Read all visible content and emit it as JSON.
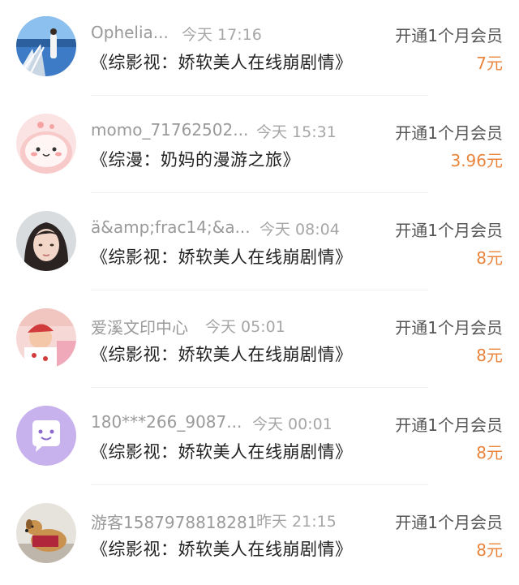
{
  "records": [
    {
      "name": "Ophelia...",
      "time": "今天 17:16",
      "title": "《综影视：娇软美人在线崩剧情》",
      "plan": "开通1个月会员",
      "price": "7元",
      "avatar": "ocean-avatar-icon"
    },
    {
      "name": "momo_71762502...",
      "time": "今天 15:31",
      "title": "《综漫：奶妈的漫游之旅》",
      "plan": "开通1个月会员",
      "price": "3.96元",
      "avatar": "pink-cartoon-avatar-icon"
    },
    {
      "name": "ä&amp;frac14;&a...",
      "time": "今天 08:04",
      "title": "《综影视：娇软美人在线崩剧情》",
      "plan": "开通1个月会员",
      "price": "8元",
      "avatar": "girl-portrait-avatar-icon"
    },
    {
      "name": "爱溪文印中心",
      "time": "今天 05:01",
      "title": "《综影视：娇软美人在线崩剧情》",
      "plan": "开通1个月会员",
      "price": "8元",
      "avatar": "baby-photo-avatar-icon"
    },
    {
      "name": "180***266_9087...",
      "time": "今天 00:01",
      "title": "《综影视：娇软美人在线崩剧情》",
      "plan": "开通1个月会员",
      "price": "8元",
      "avatar": "chat-bubble-avatar-icon"
    },
    {
      "name": "游客1587978818281",
      "time": "昨天 21:15",
      "title": "《综影视：娇软美人在线崩剧情》",
      "plan": "开通1个月会员",
      "price": "8元",
      "avatar": "dog-avatar-icon"
    }
  ],
  "colors": {
    "price": "#e9853d",
    "name": "#9a9a9a",
    "title": "#222222"
  }
}
